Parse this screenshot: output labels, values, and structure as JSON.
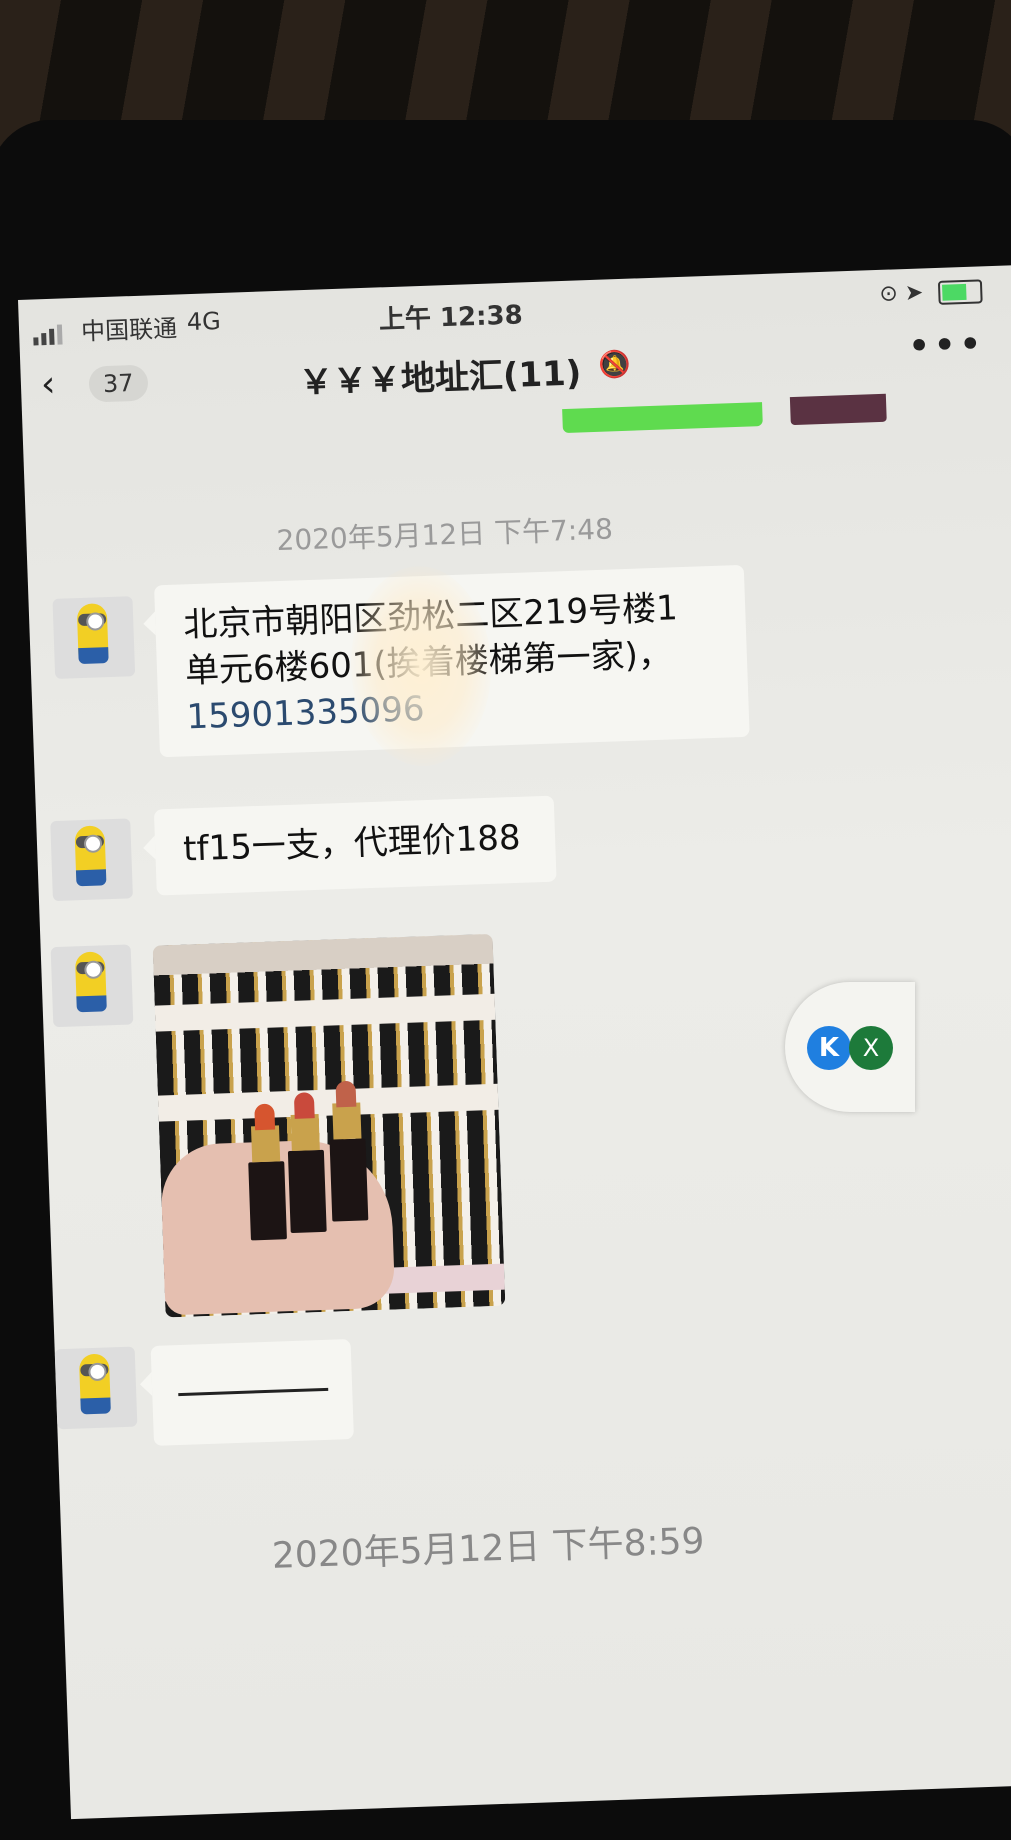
{
  "status_bar": {
    "carrier": "中国联通",
    "network": "4G",
    "time": "上午 12:38",
    "battery_level": 0.7,
    "icons": [
      "signal-icon",
      "orientation-lock-icon",
      "location-icon",
      "battery-icon"
    ]
  },
  "header": {
    "unread_count": "37",
    "title": "￥￥￥地址汇(11)",
    "muted_icon": "bell-muted-icon",
    "more_icon": "more-icon"
  },
  "messages": [
    {
      "type": "timestamp",
      "text": "2020年5月12日 下午7:48"
    },
    {
      "type": "text",
      "sender_avatar": "minion-avatar",
      "lines": [
        "北京市朝阳区劲松二区219号楼1",
        "单元6楼601(挨着楼梯第一家)，"
      ],
      "phone": "15901335096"
    },
    {
      "type": "text",
      "sender_avatar": "minion-avatar",
      "text": "tf15一支，代理价188"
    },
    {
      "type": "image",
      "sender_avatar": "minion-avatar",
      "image_subject": "lipstick-display-photo"
    },
    {
      "type": "text",
      "sender_avatar": "minion-avatar",
      "text": ""
    },
    {
      "type": "timestamp",
      "text": "2020年5月12日 下午8:59"
    }
  ],
  "floating_button": {
    "left_icon": "K",
    "right_icon": "X"
  },
  "colors": {
    "screen_bg": "#e8e8e4",
    "bubble_bg": "#f6f6f2",
    "accent_green": "#5fdb4f",
    "k_icon": "#1f7fe0",
    "x_icon": "#1d7a3a"
  }
}
